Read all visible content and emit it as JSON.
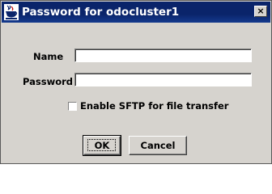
{
  "window": {
    "title": "Password for odocluster1",
    "close_label": "×"
  },
  "form": {
    "name_label": "Name",
    "name_value": "",
    "password_label": "Password",
    "password_value": "",
    "sftp_label": "Enable SFTP for file transfer",
    "sftp_checked": false
  },
  "buttons": {
    "ok_label": "OK",
    "cancel_label": "Cancel"
  },
  "colors": {
    "titlebar": "#0a246a",
    "dialog_bg": "#d6d3ce"
  },
  "icons": {
    "app": "java-cup-icon",
    "close": "close-icon"
  }
}
